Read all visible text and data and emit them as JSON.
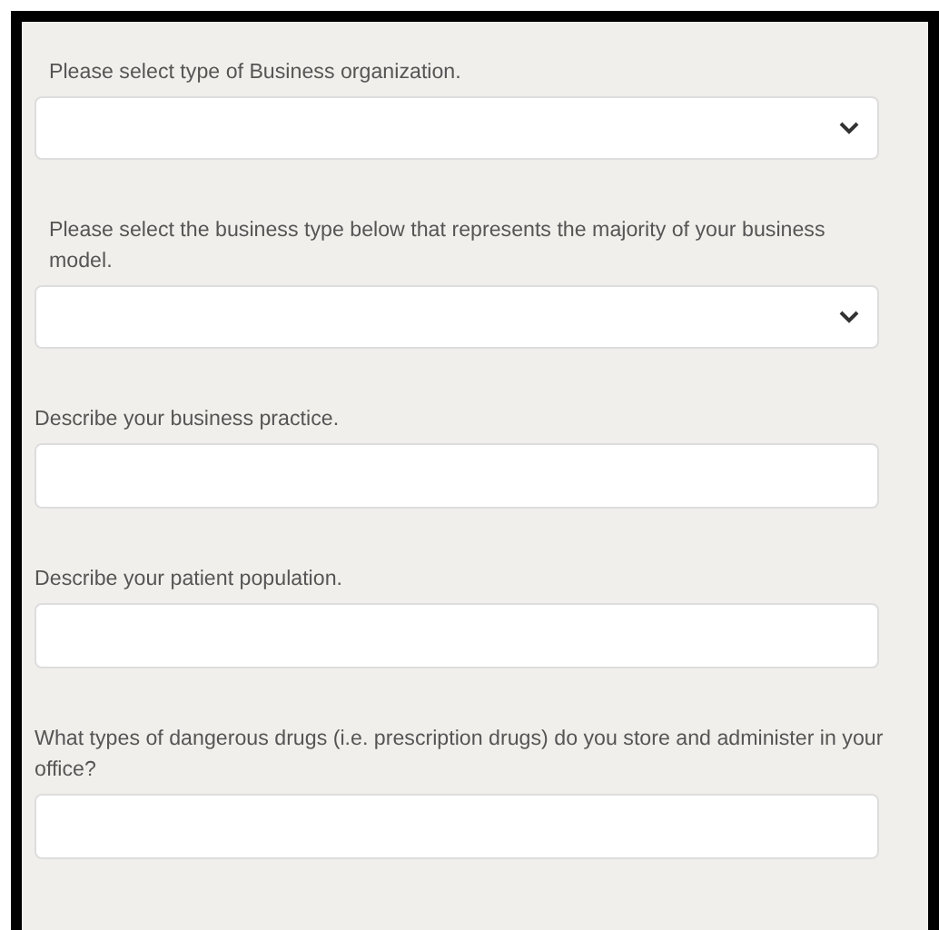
{
  "fields": [
    {
      "kind": "select",
      "label": "Please select type of Business organization."
    },
    {
      "kind": "select",
      "label": "Please select the business type below that represents the majority of your business model."
    },
    {
      "kind": "text",
      "label": "Describe your business practice."
    },
    {
      "kind": "text",
      "label": "Describe your patient population."
    },
    {
      "kind": "text",
      "label": "What types of dangerous drugs (i.e. prescription drugs) do you store and administer in your office?"
    }
  ]
}
